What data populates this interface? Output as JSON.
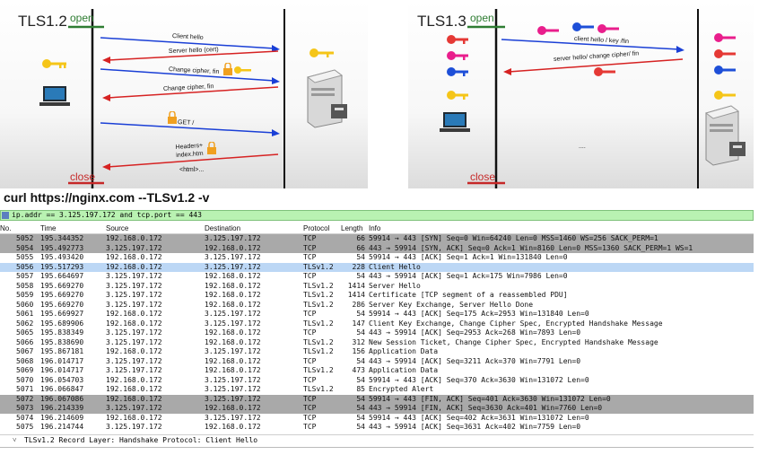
{
  "tls12": {
    "title": "TLS1.2",
    "open_label": "open",
    "close_label": "close",
    "arrows": [
      "Client hello",
      "Server hello (cert)",
      "Change cipher, fin",
      "Change cipher, fin",
      "GET /",
      "Headers+ index.htm",
      "<html>..."
    ]
  },
  "tls13": {
    "title": "TLS1.3",
    "open_label": "open",
    "close_label": "close",
    "arrows": [
      "client hello / key /fin",
      "server hello/ change cipher/ fin",
      "...."
    ],
    "key_colors": [
      "#e53935",
      "#e91e8c",
      "#1e4fd8",
      "#f5c518"
    ]
  },
  "curl_command": "curl https://nginx.com --TLSv1.2 -v",
  "filter": "ip.addr == 3.125.197.172 and tcp.port == 443",
  "columns": {
    "no": "No.",
    "time": "Time",
    "source": "Source",
    "destination": "Destination",
    "protocol": "Protocol",
    "length": "Length",
    "info": "Info"
  },
  "packets": [
    {
      "no": "5052",
      "time": "195.344352",
      "src": "192.168.0.172",
      "dst": "3.125.197.172",
      "proto": "TCP",
      "len": "66",
      "info": "59914 → 443 [SYN] Seq=0 Win=64240 Len=0 MSS=1460 WS=256 SACK_PERM=1",
      "style": "gray"
    },
    {
      "no": "5054",
      "time": "195.492773",
      "src": "3.125.197.172",
      "dst": "192.168.0.172",
      "proto": "TCP",
      "len": "66",
      "info": "443 → 59914 [SYN, ACK] Seq=0 Ack=1 Win=8160 Len=0 MSS=1360 SACK_PERM=1 WS=1",
      "style": "gray"
    },
    {
      "no": "5055",
      "time": "195.493420",
      "src": "192.168.0.172",
      "dst": "3.125.197.172",
      "proto": "TCP",
      "len": "54",
      "info": "59914 → 443 [ACK] Seq=1 Ack=1 Win=131840 Len=0",
      "style": ""
    },
    {
      "no": "5056",
      "time": "195.517293",
      "src": "192.168.0.172",
      "dst": "3.125.197.172",
      "proto": "TLSv1.2",
      "len": "228",
      "info": "Client Hello",
      "style": "sel"
    },
    {
      "no": "5057",
      "time": "195.664697",
      "src": "3.125.197.172",
      "dst": "192.168.0.172",
      "proto": "TCP",
      "len": "54",
      "info": "443 → 59914 [ACK] Seq=1 Ack=175 Win=7986 Len=0",
      "style": ""
    },
    {
      "no": "5058",
      "time": "195.669270",
      "src": "3.125.197.172",
      "dst": "192.168.0.172",
      "proto": "TLSv1.2",
      "len": "1414",
      "info": "Server Hello",
      "style": ""
    },
    {
      "no": "5059",
      "time": "195.669270",
      "src": "3.125.197.172",
      "dst": "192.168.0.172",
      "proto": "TLSv1.2",
      "len": "1414",
      "info": "Certificate [TCP segment of a reassembled PDU]",
      "style": ""
    },
    {
      "no": "5060",
      "time": "195.669270",
      "src": "3.125.197.172",
      "dst": "192.168.0.172",
      "proto": "TLSv1.2",
      "len": "286",
      "info": "Server Key Exchange, Server Hello Done",
      "style": ""
    },
    {
      "no": "5061",
      "time": "195.669927",
      "src": "192.168.0.172",
      "dst": "3.125.197.172",
      "proto": "TCP",
      "len": "54",
      "info": "59914 → 443 [ACK] Seq=175 Ack=2953 Win=131840 Len=0",
      "style": ""
    },
    {
      "no": "5062",
      "time": "195.689906",
      "src": "192.168.0.172",
      "dst": "3.125.197.172",
      "proto": "TLSv1.2",
      "len": "147",
      "info": "Client Key Exchange, Change Cipher Spec, Encrypted Handshake Message",
      "style": ""
    },
    {
      "no": "5065",
      "time": "195.838349",
      "src": "3.125.197.172",
      "dst": "192.168.0.172",
      "proto": "TCP",
      "len": "54",
      "info": "443 → 59914 [ACK] Seq=2953 Ack=268 Win=7893 Len=0",
      "style": ""
    },
    {
      "no": "5066",
      "time": "195.838690",
      "src": "3.125.197.172",
      "dst": "192.168.0.172",
      "proto": "TLSv1.2",
      "len": "312",
      "info": "New Session Ticket, Change Cipher Spec, Encrypted Handshake Message",
      "style": ""
    },
    {
      "no": "5067",
      "time": "195.867181",
      "src": "192.168.0.172",
      "dst": "3.125.197.172",
      "proto": "TLSv1.2",
      "len": "156",
      "info": "Application Data",
      "style": ""
    },
    {
      "no": "5068",
      "time": "196.014717",
      "src": "3.125.197.172",
      "dst": "192.168.0.172",
      "proto": "TCP",
      "len": "54",
      "info": "443 → 59914 [ACK] Seq=3211 Ack=370 Win=7791 Len=0",
      "style": ""
    },
    {
      "no": "5069",
      "time": "196.014717",
      "src": "3.125.197.172",
      "dst": "192.168.0.172",
      "proto": "TLSv1.2",
      "len": "473",
      "info": "Application Data",
      "style": ""
    },
    {
      "no": "5070",
      "time": "196.054703",
      "src": "192.168.0.172",
      "dst": "3.125.197.172",
      "proto": "TCP",
      "len": "54",
      "info": "59914 → 443 [ACK] Seq=370 Ack=3630 Win=131072 Len=0",
      "style": ""
    },
    {
      "no": "5071",
      "time": "196.066847",
      "src": "192.168.0.172",
      "dst": "3.125.197.172",
      "proto": "TLSv1.2",
      "len": "85",
      "info": "Encrypted Alert",
      "style": ""
    },
    {
      "no": "5072",
      "time": "196.067086",
      "src": "192.168.0.172",
      "dst": "3.125.197.172",
      "proto": "TCP",
      "len": "54",
      "info": "59914 → 443 [FIN, ACK] Seq=401 Ack=3630 Win=131072 Len=0",
      "style": "gray"
    },
    {
      "no": "5073",
      "time": "196.214339",
      "src": "3.125.197.172",
      "dst": "192.168.0.172",
      "proto": "TCP",
      "len": "54",
      "info": "443 → 59914 [FIN, ACK] Seq=3630 Ack=401 Win=7760 Len=0",
      "style": "gray"
    },
    {
      "no": "5074",
      "time": "196.214609",
      "src": "192.168.0.172",
      "dst": "3.125.197.172",
      "proto": "TCP",
      "len": "54",
      "info": "59914 → 443 [ACK] Seq=402 Ack=3631 Win=131072 Len=0",
      "style": ""
    },
    {
      "no": "5075",
      "time": "196.214744",
      "src": "3.125.197.172",
      "dst": "192.168.0.172",
      "proto": "TCP",
      "len": "54",
      "info": "443 → 59914 [ACK] Seq=3631 Ack=402 Win=7759 Len=0",
      "style": ""
    }
  ],
  "detail": {
    "expander": "˅",
    "text": "TLSv1.2 Record Layer: Handshake Protocol: Client Hello"
  }
}
